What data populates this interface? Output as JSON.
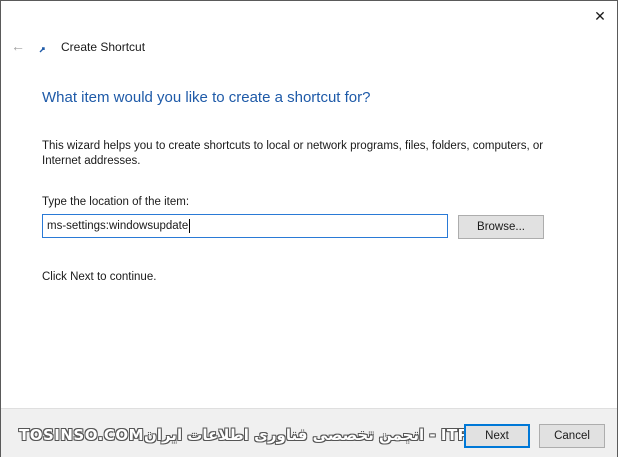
{
  "window": {
    "close_glyph": "✕",
    "close_icon": "close-icon"
  },
  "header": {
    "back_icon": "back-arrow-icon",
    "back_glyph": "←",
    "wizard_icon": "shortcut-wizard-icon",
    "title": "Create Shortcut"
  },
  "main": {
    "heading": "What item would you like to create a shortcut for?",
    "description": "This wizard helps you to create shortcuts to local or network programs, files, folders, computers, or Internet addresses.",
    "location_label": "Type the location of the item:",
    "location_value": "ms-settings:windowsupdate",
    "browse_label": "Browse...",
    "continue_text": "Click Next to continue."
  },
  "footer": {
    "watermark": "TOSINSO.COMانجمن تخصصی فناوری اطلاعات ایران - ITPro.ir",
    "next_label": "Next",
    "cancel_label": "Cancel"
  },
  "colors": {
    "heading": "#1e5aa8",
    "input_border": "#2a7ad6",
    "default_button_border": "#0078d7",
    "footer_bg": "#f0f0f0"
  }
}
